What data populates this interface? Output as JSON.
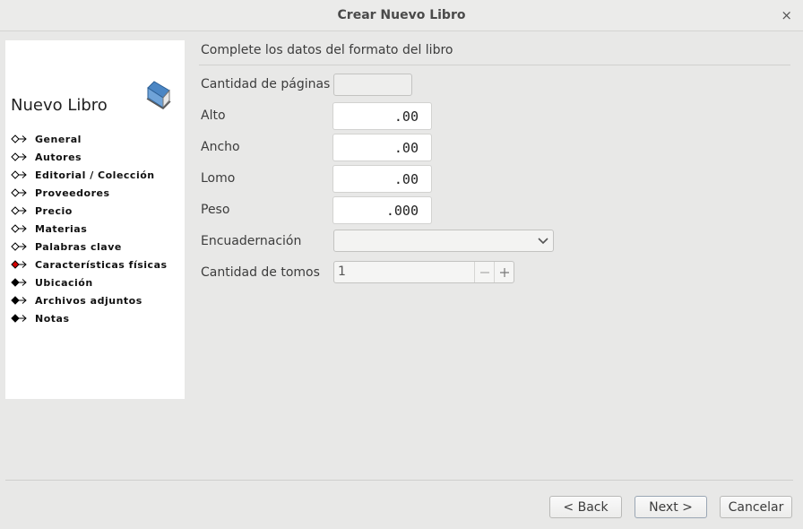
{
  "window": {
    "title": "Crear Nuevo Libro",
    "close_glyph": "×"
  },
  "sidebar": {
    "heading": "Nuevo Libro",
    "icon": "book-icon",
    "steps": [
      {
        "label": "General",
        "state": "done"
      },
      {
        "label": "Autores",
        "state": "done"
      },
      {
        "label": "Editorial / Colección",
        "state": "done"
      },
      {
        "label": "Proveedores",
        "state": "done"
      },
      {
        "label": "Precio",
        "state": "done"
      },
      {
        "label": "Materias",
        "state": "done"
      },
      {
        "label": "Palabras clave",
        "state": "done"
      },
      {
        "label": "Características físicas",
        "state": "current"
      },
      {
        "label": "Ubicación",
        "state": "pending"
      },
      {
        "label": "Archivos adjuntos",
        "state": "pending"
      },
      {
        "label": "Notas",
        "state": "pending"
      }
    ],
    "marker_colors": {
      "done": "#ffffff",
      "current": "#d40000",
      "pending": "#000000"
    }
  },
  "form": {
    "title": "Complete los datos del formato del libro",
    "pages": {
      "label": "Cantidad de páginas",
      "value": ""
    },
    "alto": {
      "label": "Alto",
      "value": ".00"
    },
    "ancho": {
      "label": "Ancho",
      "value": ".00"
    },
    "lomo": {
      "label": "Lomo",
      "value": ".00"
    },
    "peso": {
      "label": "Peso",
      "value": ".000"
    },
    "encuadernacion": {
      "label": "Encuadernación",
      "value": ""
    },
    "tomos": {
      "label": "Cantidad de tomos",
      "value": "1"
    }
  },
  "buttons": {
    "back": "< Back",
    "next": "Next >",
    "cancel": "Cancelar"
  }
}
